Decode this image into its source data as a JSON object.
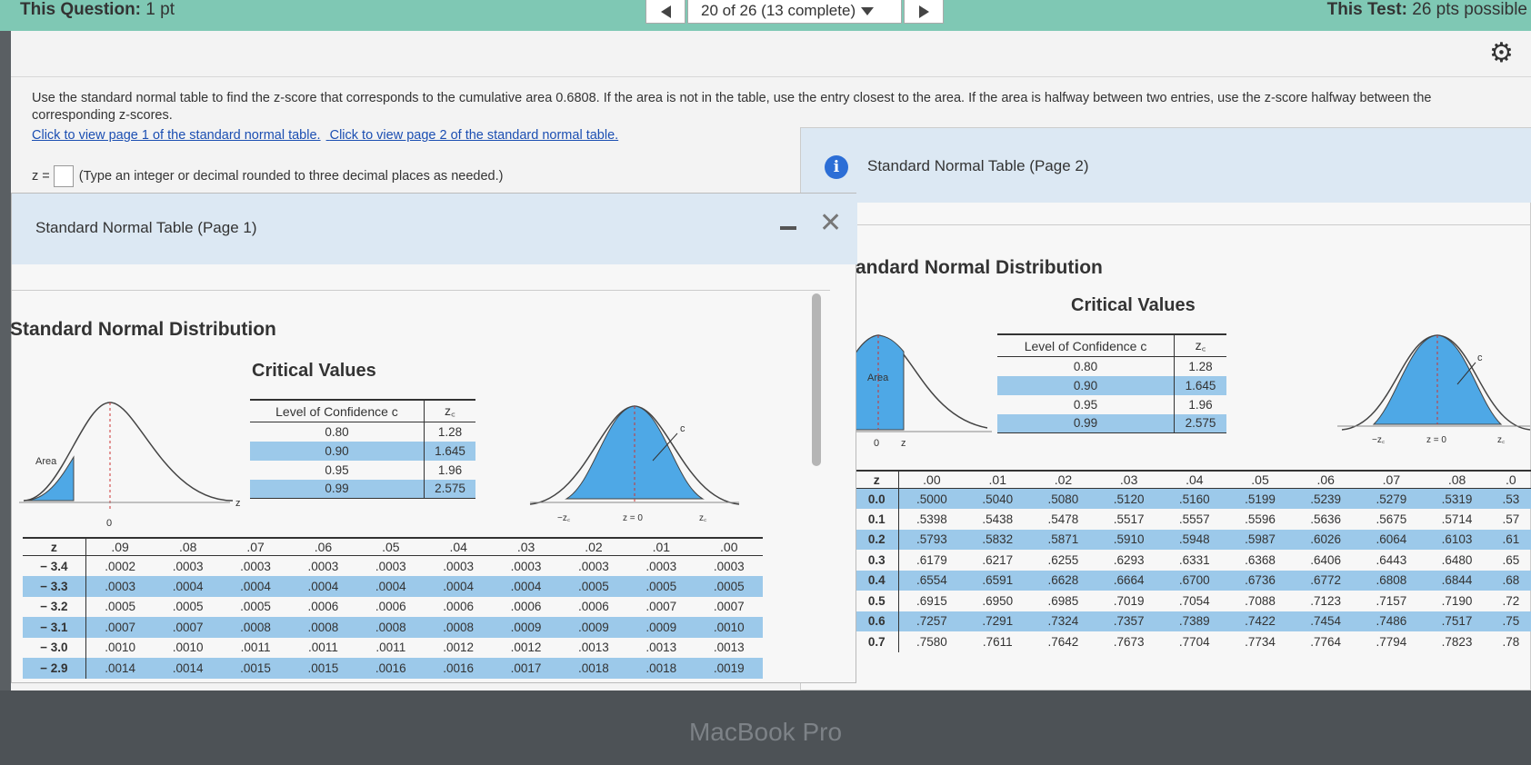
{
  "topbar": {
    "question_label": "This Question:",
    "question_points": " 1 pt",
    "progress": "20 of 26 (13 complete)",
    "test_label": "This Test:",
    "test_points": " 26 pts possible"
  },
  "question": {
    "text": "Use the standard normal table to find the z-score that corresponds to the cumulative area 0.6808. If the area is not in the table, use the entry closest to the area. If the area is halfway between two entries, use the z-score halfway between the corresponding z-scores.",
    "link1": "Click to view page 1 of the standard normal table.",
    "link2": "Click to view page 2 of the standard normal table.",
    "answer_prefix": "z =",
    "answer_hint": "(Type an integer or decimal rounded to three decimal places as needed.)"
  },
  "page1": {
    "title": "Standard Normal Table (Page 1)",
    "heading": "Standard Normal Distribution",
    "critical_title": "Critical Values",
    "crit_headers": [
      "Level of Confidence c",
      "z꜀"
    ],
    "crit_rows": [
      [
        "0.80",
        "1.28"
      ],
      [
        "0.90",
        "1.645"
      ],
      [
        "0.95",
        "1.96"
      ],
      [
        "0.99",
        "2.575"
      ]
    ],
    "curve_labels": {
      "area": "Area",
      "z": "z",
      "zero": "0",
      "c": "c",
      "neg_zc": "−z꜀",
      "z_eq_0": "z = 0",
      "zc": "z꜀"
    },
    "z_headers": [
      "z",
      ".09",
      ".08",
      ".07",
      ".06",
      ".05",
      ".04",
      ".03",
      ".02",
      ".01",
      ".00"
    ],
    "z_rows": [
      [
        "− 3.4",
        ".0002",
        ".0003",
        ".0003",
        ".0003",
        ".0003",
        ".0003",
        ".0003",
        ".0003",
        ".0003",
        ".0003"
      ],
      [
        "− 3.3",
        ".0003",
        ".0004",
        ".0004",
        ".0004",
        ".0004",
        ".0004",
        ".0004",
        ".0005",
        ".0005",
        ".0005"
      ],
      [
        "− 3.2",
        ".0005",
        ".0005",
        ".0005",
        ".0006",
        ".0006",
        ".0006",
        ".0006",
        ".0006",
        ".0007",
        ".0007"
      ],
      [
        "− 3.1",
        ".0007",
        ".0007",
        ".0008",
        ".0008",
        ".0008",
        ".0008",
        ".0009",
        ".0009",
        ".0009",
        ".0010"
      ],
      [
        "− 3.0",
        ".0010",
        ".0010",
        ".0011",
        ".0011",
        ".0011",
        ".0012",
        ".0012",
        ".0013",
        ".0013",
        ".0013"
      ],
      [
        "− 2.9",
        ".0014",
        ".0014",
        ".0015",
        ".0015",
        ".0016",
        ".0016",
        ".0017",
        ".0018",
        ".0018",
        ".0019"
      ]
    ]
  },
  "page2": {
    "title": "Standard Normal Table (Page 2)",
    "heading": "andard Normal Distribution",
    "critical_title": "Critical Values",
    "crit_headers": [
      "Level of Confidence c",
      "z꜀"
    ],
    "crit_rows": [
      [
        "0.80",
        "1.28"
      ],
      [
        "0.90",
        "1.645"
      ],
      [
        "0.95",
        "1.96"
      ],
      [
        "0.99",
        "2.575"
      ]
    ],
    "curve_labels": {
      "area": "Area",
      "z": "z",
      "zero": "0",
      "c": "c",
      "neg_zc": "−z꜀",
      "z_eq_0": "z = 0",
      "zc": "z꜀"
    },
    "z_headers": [
      "z",
      ".00",
      ".01",
      ".02",
      ".03",
      ".04",
      ".05",
      ".06",
      ".07",
      ".08",
      ".0"
    ],
    "z_rows": [
      [
        "0.0",
        ".5000",
        ".5040",
        ".5080",
        ".5120",
        ".5160",
        ".5199",
        ".5239",
        ".5279",
        ".5319",
        ".53"
      ],
      [
        "0.1",
        ".5398",
        ".5438",
        ".5478",
        ".5517",
        ".5557",
        ".5596",
        ".5636",
        ".5675",
        ".5714",
        ".57"
      ],
      [
        "0.2",
        ".5793",
        ".5832",
        ".5871",
        ".5910",
        ".5948",
        ".5987",
        ".6026",
        ".6064",
        ".6103",
        ".61"
      ],
      [
        "0.3",
        ".6179",
        ".6217",
        ".6255",
        ".6293",
        ".6331",
        ".6368",
        ".6406",
        ".6443",
        ".6480",
        ".65"
      ],
      [
        "0.4",
        ".6554",
        ".6591",
        ".6628",
        ".6664",
        ".6700",
        ".6736",
        ".6772",
        ".6808",
        ".6844",
        ".68"
      ],
      [
        "0.5",
        ".6915",
        ".6950",
        ".6985",
        ".7019",
        ".7054",
        ".7088",
        ".7123",
        ".7157",
        ".7190",
        ".72"
      ],
      [
        "0.6",
        ".7257",
        ".7291",
        ".7324",
        ".7357",
        ".7389",
        ".7422",
        ".7454",
        ".7486",
        ".7517",
        ".75"
      ],
      [
        "0.7",
        ".7580",
        ".7611",
        ".7642",
        ".7673",
        ".7704",
        ".7734",
        ".7764",
        ".7794",
        ".7823",
        ".78"
      ]
    ]
  },
  "device_label": "MacBook Pro",
  "colors": {
    "topbar": "#7fc8b4",
    "highlight": "#9cc9ea",
    "curve_fill": "#4ea8e6",
    "link": "#1c4fb2"
  }
}
